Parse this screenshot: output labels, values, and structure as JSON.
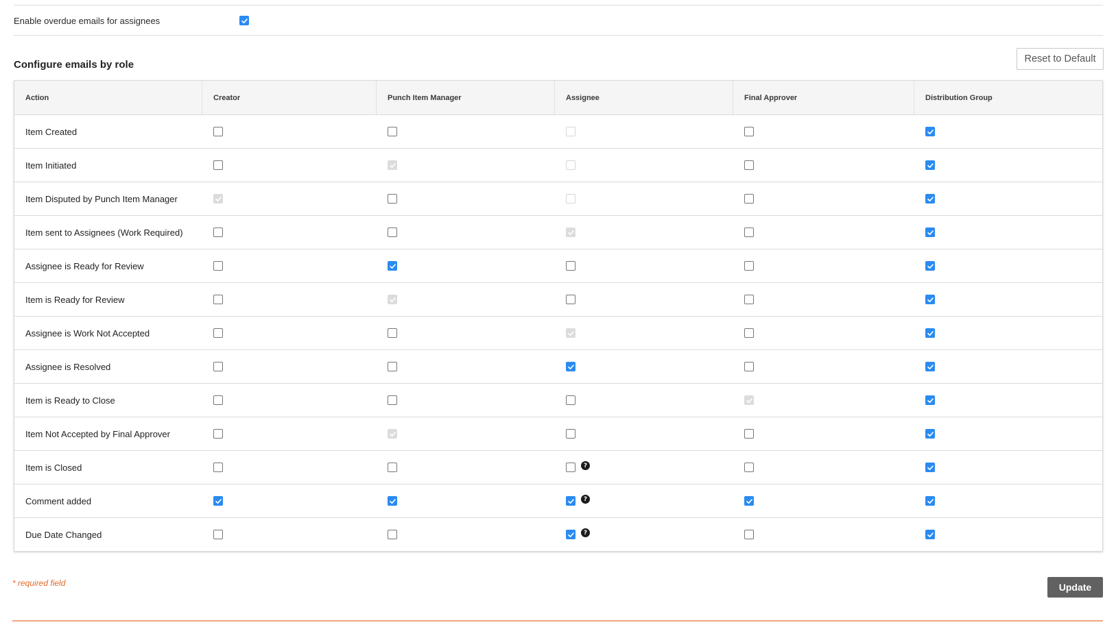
{
  "overdue": {
    "label": "Enable overdue emails for assignees",
    "checked": true
  },
  "section_title": "Configure emails by role",
  "reset_label": "Reset to Default",
  "columns": [
    "Action",
    "Creator",
    "Punch Item Manager",
    "Assignee",
    "Final Approver",
    "Distribution Group"
  ],
  "rows": [
    {
      "action": "Item Created",
      "cells": [
        "unchecked",
        "unchecked",
        "unchecked-disabled",
        "unchecked",
        "checked"
      ],
      "help": false
    },
    {
      "action": "Item Initiated",
      "cells": [
        "unchecked",
        "checked-disabled",
        "unchecked-disabled",
        "unchecked",
        "checked"
      ],
      "help": false
    },
    {
      "action": "Item Disputed by Punch Item Manager",
      "cells": [
        "checked-disabled",
        "unchecked",
        "unchecked-disabled",
        "unchecked",
        "checked"
      ],
      "help": false
    },
    {
      "action": "Item sent to Assignees (Work Required)",
      "cells": [
        "unchecked",
        "unchecked",
        "checked-disabled",
        "unchecked",
        "checked"
      ],
      "help": false
    },
    {
      "action": "Assignee is Ready for Review",
      "cells": [
        "unchecked",
        "checked",
        "unchecked",
        "unchecked",
        "checked"
      ],
      "help": false
    },
    {
      "action": "Item is Ready for Review",
      "cells": [
        "unchecked",
        "checked-disabled",
        "unchecked",
        "unchecked",
        "checked"
      ],
      "help": false
    },
    {
      "action": "Assignee is Work Not Accepted",
      "cells": [
        "unchecked",
        "unchecked",
        "checked-disabled",
        "unchecked",
        "checked"
      ],
      "help": false
    },
    {
      "action": "Assignee is Resolved",
      "cells": [
        "unchecked",
        "unchecked",
        "checked",
        "unchecked",
        "checked"
      ],
      "help": false
    },
    {
      "action": "Item is Ready to Close",
      "cells": [
        "unchecked",
        "unchecked",
        "unchecked",
        "checked-disabled",
        "checked"
      ],
      "help": false
    },
    {
      "action": "Item Not Accepted by Final Approver",
      "cells": [
        "unchecked",
        "checked-disabled",
        "unchecked",
        "unchecked",
        "checked"
      ],
      "help": false
    },
    {
      "action": "Item is Closed",
      "cells": [
        "unchecked",
        "unchecked",
        "unchecked",
        "unchecked",
        "checked"
      ],
      "help": true
    },
    {
      "action": "Comment added",
      "cells": [
        "checked",
        "checked",
        "checked",
        "checked",
        "checked"
      ],
      "help": true
    },
    {
      "action": "Due Date Changed",
      "cells": [
        "unchecked",
        "unchecked",
        "checked",
        "unchecked",
        "checked"
      ],
      "help": true
    }
  ],
  "help_glyph": "?",
  "required_note": "* required field",
  "update_label": "Update",
  "colors": {
    "accent": "#2a8bf2",
    "update_bg": "#616161",
    "required": "#e06a2a",
    "footer_line": "#f0a57a"
  },
  "icons": {
    "check": "checkmark-icon",
    "help": "question-circle-icon"
  }
}
